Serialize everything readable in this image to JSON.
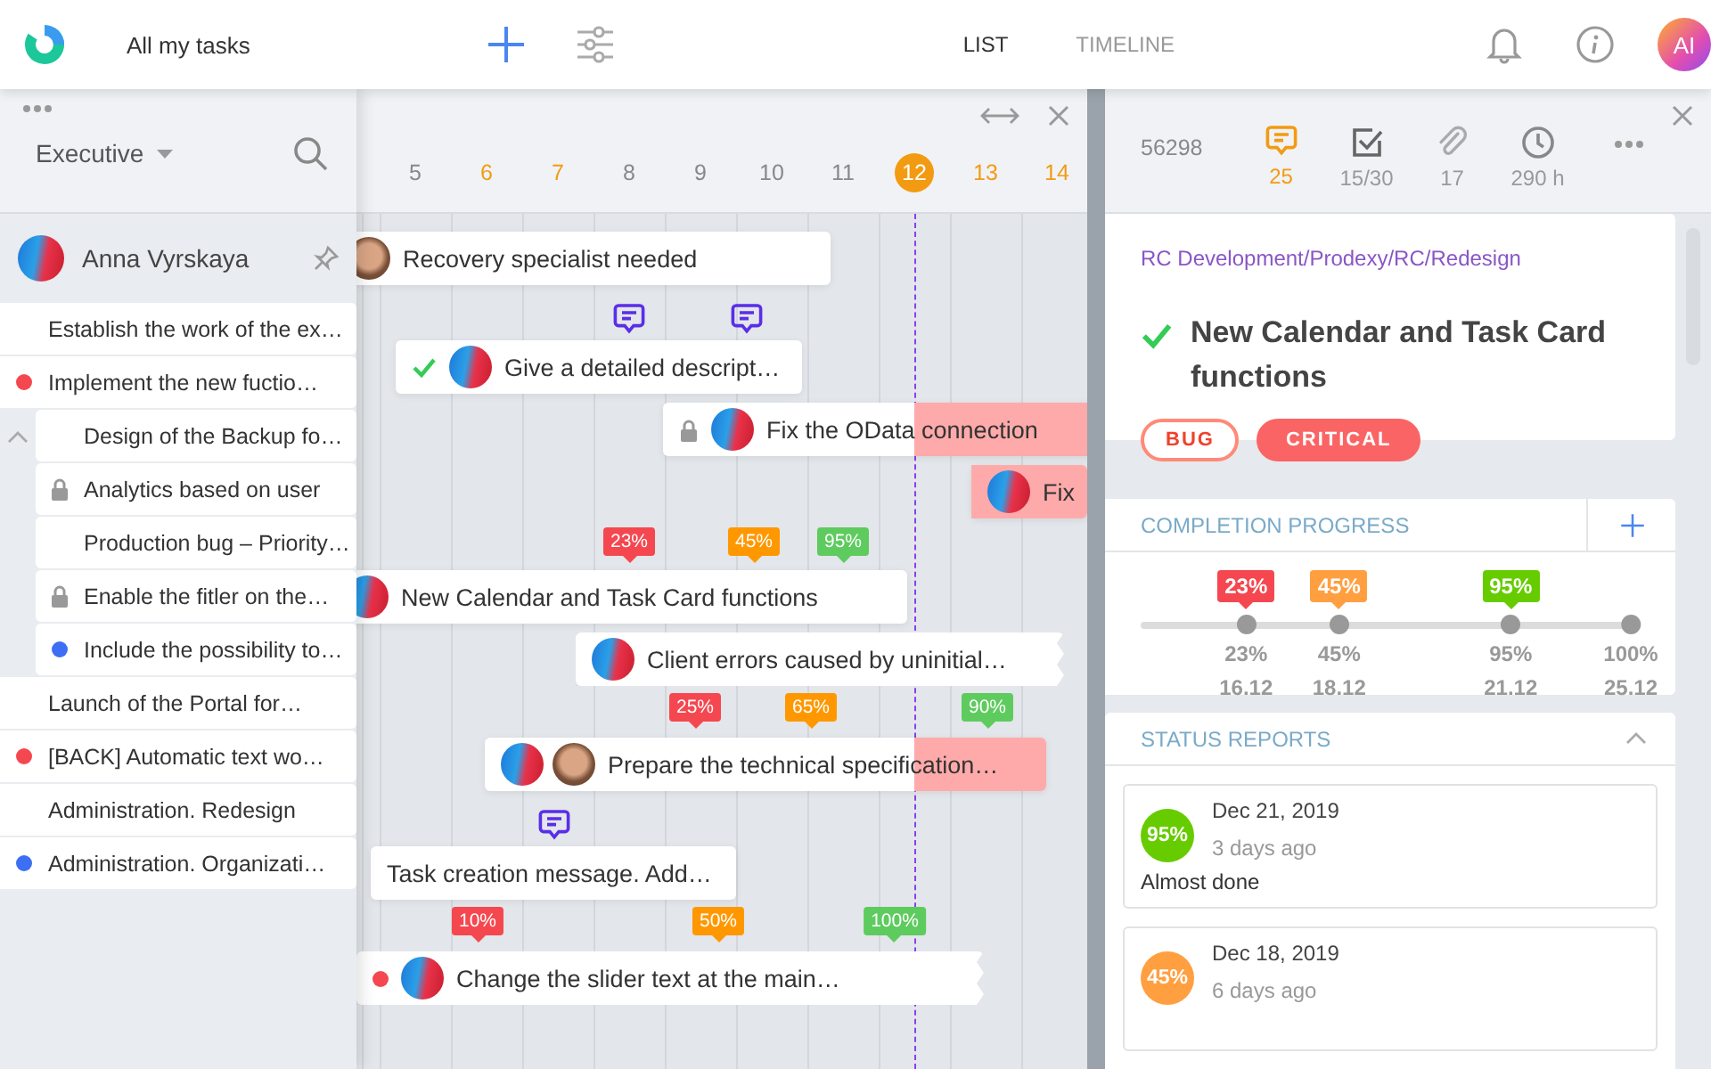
{
  "app": {
    "title": "All my tasks"
  },
  "view_tabs": [
    {
      "label": "LIST",
      "selected": true
    },
    {
      "label": "TIMELINE",
      "selected": false
    }
  ],
  "user_avatar": {
    "initials": "AI"
  },
  "sidebar": {
    "filter": "Executive",
    "assignee": "Anna Vyrskaya",
    "tasks": [
      {
        "title": "Establish the work of the ex…",
        "kind": "plain"
      },
      {
        "title": "Implement the new fuctio…",
        "kind": "dot",
        "color": "#f5474f",
        "expanded": true,
        "children": [
          {
            "title": "Design of the Backup fo…",
            "kind": "plain"
          },
          {
            "title": "Analytics based on user",
            "kind": "lock"
          },
          {
            "title": "Production bug – Priority…",
            "kind": "plain"
          },
          {
            "title": "Enable the fitler on the…",
            "kind": "lock"
          },
          {
            "title": "Include the possibility to…",
            "kind": "dot",
            "color": "#3d6ff5"
          }
        ]
      },
      {
        "title": "Launch of the Portal for…",
        "kind": "plain"
      },
      {
        "title": "[BACK] Automatic text wo…",
        "kind": "dot",
        "color": "#f5474f"
      },
      {
        "title": "Administration. Redesign",
        "kind": "plain"
      },
      {
        "title": "Administration. Organizati…",
        "kind": "dot",
        "color": "#3d6ff5"
      }
    ]
  },
  "timeline": {
    "days": [
      {
        "label": "5",
        "weekend": false,
        "today": false
      },
      {
        "label": "6",
        "weekend": true,
        "today": false
      },
      {
        "label": "7",
        "weekend": true,
        "today": false
      },
      {
        "label": "8",
        "weekend": false,
        "today": false
      },
      {
        "label": "9",
        "weekend": false,
        "today": false
      },
      {
        "label": "10",
        "weekend": false,
        "today": false
      },
      {
        "label": "11",
        "weekend": false,
        "today": false
      },
      {
        "label": "12",
        "weekend": false,
        "today": true
      },
      {
        "label": "13",
        "weekend": true,
        "today": false
      },
      {
        "label": "14",
        "weekend": true,
        "today": false
      }
    ],
    "rows": [
      {
        "kind": "bar",
        "title": "Recovery specialist needed",
        "done": false,
        "locked": false,
        "avatars": [
          {
            "kind": "photo"
          }
        ],
        "overdue": false,
        "cut": false
      },
      {
        "kind": "comment"
      },
      {
        "kind": "comment"
      },
      {
        "kind": "bar",
        "title": "Give a detailed descript…",
        "done": true,
        "locked": false,
        "avatars": [
          {
            "kind": "illustrated"
          }
        ],
        "overdue": false,
        "cut": false
      },
      {
        "kind": "bar",
        "title": "Fix the OData connection",
        "done": false,
        "locked": true,
        "avatars": [
          {
            "kind": "illustrated"
          }
        ],
        "overdue": true,
        "cut": false
      },
      {
        "kind": "bar",
        "title": "Fix",
        "done": false,
        "locked": false,
        "avatars": [
          {
            "kind": "illustrated"
          }
        ],
        "overdue": true,
        "cut": false
      },
      {
        "kind": "milestones",
        "items": [
          {
            "label": "23%",
            "color": "#f5474f"
          },
          {
            "label": "45%",
            "color": "#ff9800"
          },
          {
            "label": "95%",
            "color": "#5ecb5e"
          }
        ]
      },
      {
        "kind": "bar",
        "title": "New Calendar and Task Card functions",
        "done": false,
        "locked": false,
        "avatars": [
          {
            "kind": "illustrated"
          }
        ],
        "overdue": false,
        "cut": false
      },
      {
        "kind": "bar",
        "title": "Client errors caused by uninitial…",
        "done": false,
        "locked": false,
        "avatars": [
          {
            "kind": "illustrated"
          }
        ],
        "overdue": false,
        "cut": true
      },
      {
        "kind": "milestones",
        "items": [
          {
            "label": "25%",
            "color": "#f5474f"
          },
          {
            "label": "65%",
            "color": "#ff9800"
          },
          {
            "label": "90%",
            "color": "#5ecb5e"
          }
        ]
      },
      {
        "kind": "bar",
        "title": "Prepare the technical specification…",
        "done": false,
        "locked": false,
        "avatars": [
          {
            "kind": "illustrated"
          },
          {
            "kind": "photo"
          }
        ],
        "overdue": true,
        "cut": false
      },
      {
        "kind": "comment"
      },
      {
        "kind": "bar",
        "title": "Task creation message. Add…",
        "done": false,
        "locked": false,
        "avatars": [],
        "overdue": false,
        "cut": false
      },
      {
        "kind": "milestones",
        "items": [
          {
            "label": "10%",
            "color": "#f5474f"
          },
          {
            "label": "50%",
            "color": "#ff9800"
          },
          {
            "label": "100%",
            "color": "#5ecb5e"
          }
        ]
      },
      {
        "kind": "bar",
        "title": "Change the slider text at the main…",
        "done": false,
        "locked": false,
        "color": "#f5474f",
        "avatars": [
          {
            "kind": "illustrated"
          }
        ],
        "overdue": false,
        "cut": true
      }
    ]
  },
  "task_card": {
    "id": "56298",
    "stats": [
      {
        "kind": "comments",
        "value": "25",
        "active": true
      },
      {
        "kind": "checklist",
        "value": "15/30",
        "active": false
      },
      {
        "kind": "attachments",
        "value": "17",
        "active": false
      },
      {
        "kind": "time",
        "value": "290 h",
        "active": false
      }
    ],
    "path": "RC Development/Prodexy/RC/Redesign",
    "done": true,
    "title": "New Calendar and Task Card functions",
    "tags": [
      {
        "label": "BUG",
        "kind": "outline"
      },
      {
        "label": "CRITICAL",
        "kind": "filled"
      }
    ],
    "completion": {
      "title": "COMPLETION PROGRESS",
      "milestones": [
        {
          "badge": "23%",
          "color": "#f5474f",
          "percent": "23%",
          "date": "16.12"
        },
        {
          "badge": "45%",
          "color": "#ff9f40",
          "percent": "45%",
          "date": "18.12"
        },
        {
          "badge": "95%",
          "color": "#66cc00",
          "percent": "95%",
          "date": "21.12"
        },
        {
          "percent": "100%",
          "date": "25.12"
        }
      ]
    },
    "status_reports": {
      "title": "STATUS REPORTS",
      "expanded": true,
      "reports": [
        {
          "badge": "95%",
          "color": "#66cc00",
          "date": "Dec 21, 2019",
          "ago": "3 days ago",
          "text": "Almost done"
        },
        {
          "badge": "45%",
          "color": "#ff9f40",
          "date": "Dec 18, 2019",
          "ago": "6 days ago"
        }
      ]
    }
  }
}
